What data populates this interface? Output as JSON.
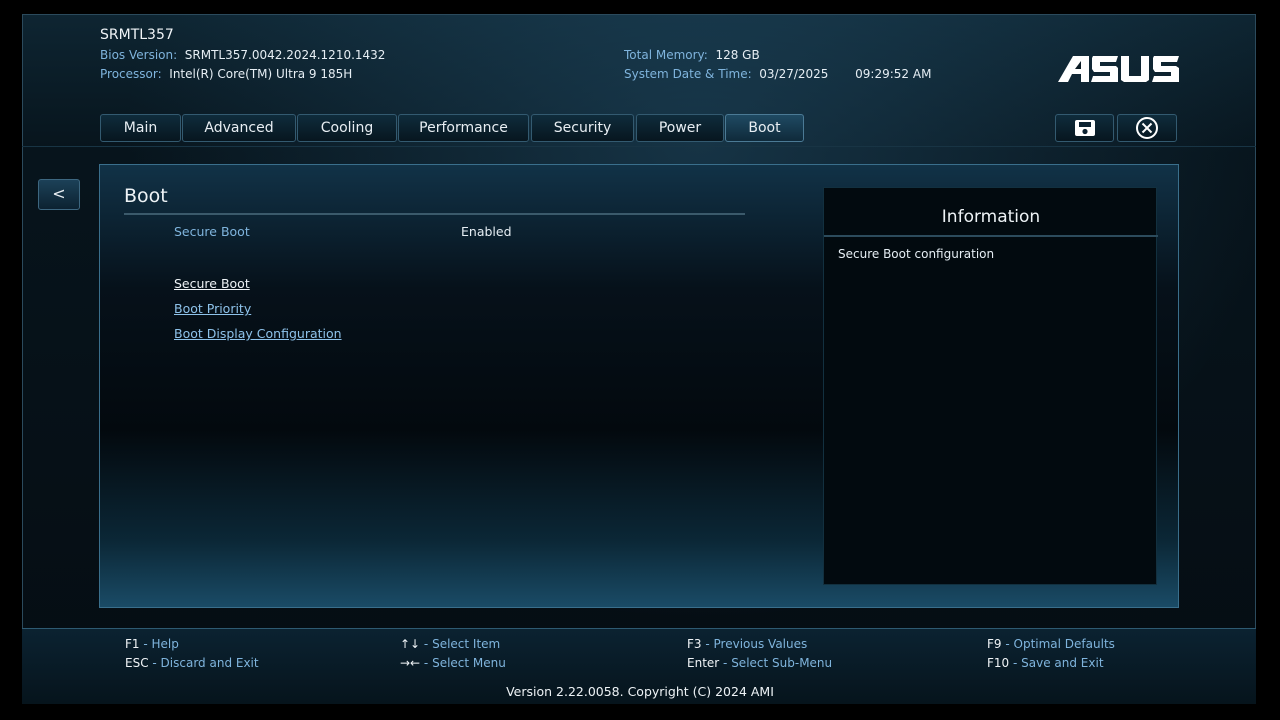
{
  "header": {
    "model": "SRMTL357",
    "bios_version_label": "Bios Version:",
    "bios_version": "SRMTL357.0042.2024.1210.1432",
    "processor_label": "Processor:",
    "processor": "Intel(R) Core(TM) Ultra 9 185H",
    "total_memory_label": "Total Memory:",
    "total_memory": "128 GB",
    "datetime_label": "System Date & Time:",
    "date": "03/27/2025",
    "time": "09:29:52 AM",
    "logo_text": "ASUS"
  },
  "tabs": [
    {
      "label": "Main"
    },
    {
      "label": "Advanced"
    },
    {
      "label": "Cooling"
    },
    {
      "label": "Performance"
    },
    {
      "label": "Security"
    },
    {
      "label": "Power"
    },
    {
      "label": "Boot",
      "active": true
    }
  ],
  "toolbar": {
    "save_icon": "save-icon",
    "exit_icon": "close-circle-icon"
  },
  "nav": {
    "back_label": "<"
  },
  "page": {
    "title": "Boot",
    "setting": {
      "name": "Secure Boot",
      "value": "Enabled"
    },
    "submenus": [
      "Secure Boot",
      "Boot Priority",
      "Boot Display Configuration"
    ]
  },
  "info": {
    "title": "Information",
    "text": "Secure Boot configuration"
  },
  "footer": {
    "keys": [
      {
        "key": "F1",
        "desc": "Help"
      },
      {
        "key": "ESC",
        "desc": "Discard and Exit"
      },
      {
        "key": "↑↓",
        "desc": "Select Item"
      },
      {
        "key": "→←",
        "desc": "Select Menu"
      },
      {
        "key": "F3",
        "desc": "Previous Values"
      },
      {
        "key": "Enter",
        "desc": "Select Sub-Menu"
      },
      {
        "key": "F9",
        "desc": "Optimal Defaults"
      },
      {
        "key": "F10",
        "desc": "Save and Exit"
      }
    ],
    "version": "Version 2.22.0058. Copyright (C) 2024 AMI"
  },
  "colors": {
    "accent": "#7fb4dd",
    "link": "#8ec2ea",
    "background": "#050d13"
  }
}
